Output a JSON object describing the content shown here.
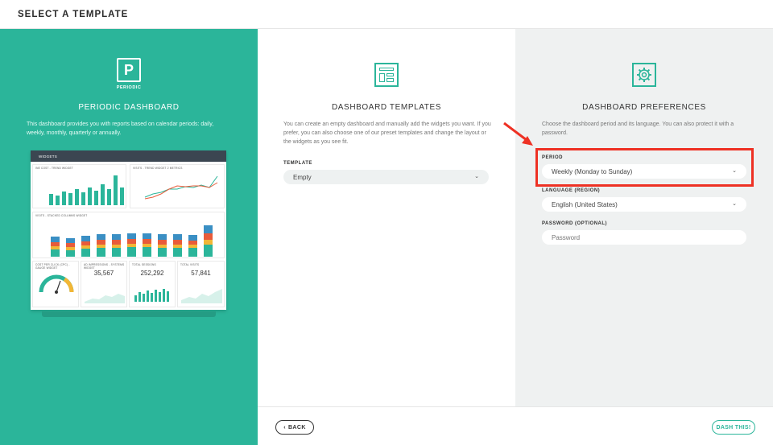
{
  "header": {
    "title": "SELECT A TEMPLATE"
  },
  "colors": {
    "accent": "#2bb59a",
    "highlight": "#ee3124"
  },
  "periodic": {
    "logo_letter": "P",
    "logo_caption": "PERIODIC",
    "title": "PERIODIC DASHBOARD",
    "description": "This dashboard provides you with reports based on calendar periods: daily, weekly, monthly, quarterly or annually.",
    "preview": {
      "header": "WIDGETS",
      "tiles": [
        {
          "caption": "INE COST - TREND WIDGET"
        },
        {
          "caption": "VISITS - TREND WIDGET 2 METRICS"
        },
        {
          "caption": "VISITS - STACKED COLUMNS WIDGET"
        },
        {
          "caption": "COST PER CLICK (CPC) - GAUGE WIDGET",
          "value": "$1.78"
        },
        {
          "caption": "AD IMPRESSIONS - SYSTEMS WIDGET",
          "value": "35,567"
        },
        {
          "caption": "TOTAL SESSIONS",
          "value": "252,292"
        },
        {
          "caption": "TOTAL VISITS",
          "value": "57,841"
        }
      ]
    }
  },
  "templates": {
    "title": "DASHBOARD TEMPLATES",
    "description": "You can create an empty dashboard and manually add the widgets you want. If you prefer, you can also choose one of our preset templates and change the layout or the widgets as you see fit.",
    "template_label": "TEMPLATE",
    "template_value": "Empty"
  },
  "preferences": {
    "title": "DASHBOARD PREFERENCES",
    "description": "Choose the dashboard period and its language. You can also protect it with a password.",
    "period_label": "PERIOD",
    "period_value": "Weekly (Monday to Sunday)",
    "language_label": "LANGUAGE (REGION)",
    "language_value": "English (United States)",
    "password_label": "PASSWORD (OPTIONAL)",
    "password_placeholder": "Password"
  },
  "footer": {
    "back_label": "BACK",
    "dash_label": "DASH THIS!"
  }
}
